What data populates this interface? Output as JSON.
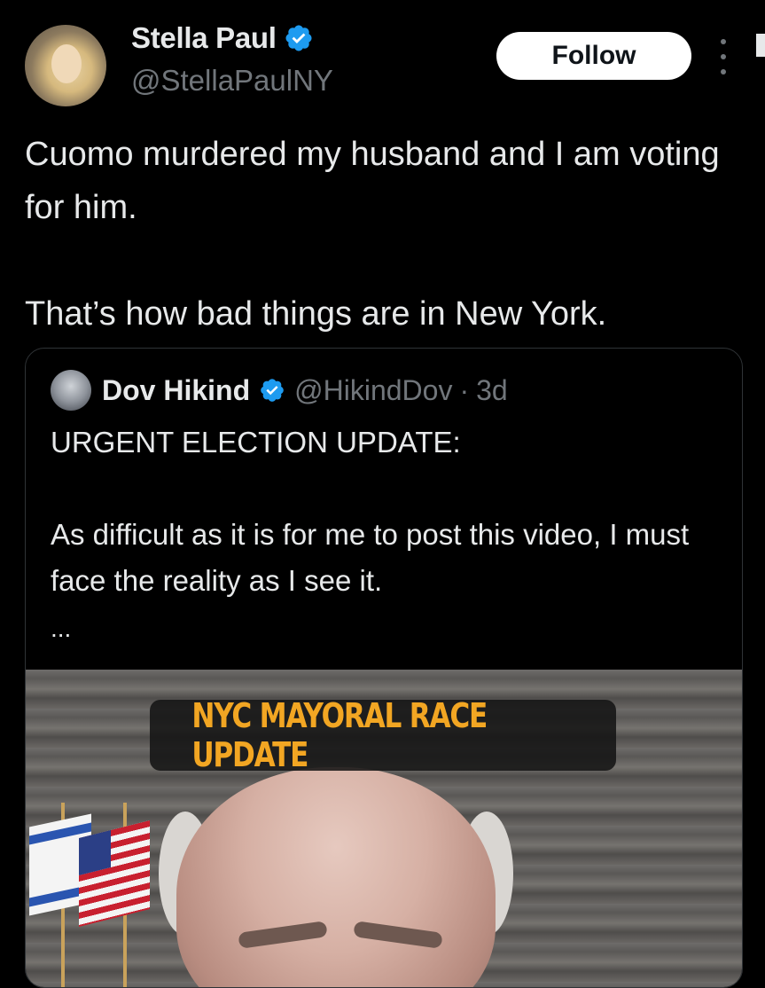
{
  "tweet": {
    "author_name": "Stella Paul",
    "author_handle": "@StellaPaulNY",
    "follow_label": "Follow",
    "text_line1": "Cuomo murdered my husband and I am voting for him.",
    "text_line2": "That’s how bad things are in New York."
  },
  "quoted_tweet": {
    "author_name": "Dov Hikind",
    "author_handle": "@HikindDov",
    "separator": "·",
    "time": "3d",
    "text_line1": "URGENT ELECTION UPDATE:",
    "text_line2": "As difficult as it is for me to post this video, I must face the reality as I see it.",
    "ellipsis": "...",
    "video_banner": "NYC MAYORAL RACE UPDATE"
  },
  "icons": {
    "verified": "verified-badge-icon",
    "more": "more-options-icon"
  },
  "colors": {
    "background": "#000000",
    "text": "#e7e9ea",
    "secondary_text": "#71767b",
    "verified_blue": "#1d9bf0",
    "banner_text": "#f2a623"
  }
}
